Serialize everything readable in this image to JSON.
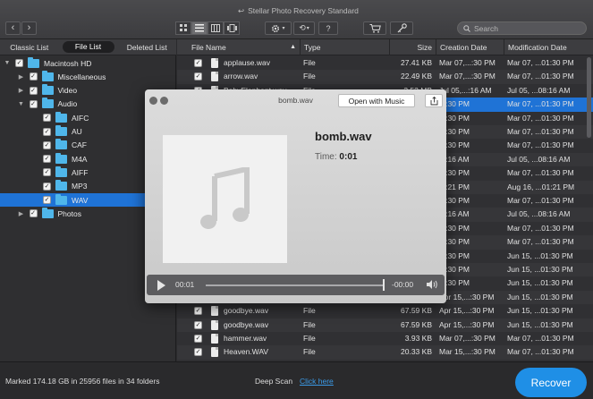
{
  "app": {
    "title": "Stellar Photo Recovery Standard"
  },
  "toolbar": {
    "back": "‹",
    "forward": "›",
    "search_placeholder": "Search",
    "history_label": "⟲",
    "help_label": "?"
  },
  "left_tabs": [
    "Classic List",
    "File List",
    "Deleted List"
  ],
  "tree": [
    {
      "label": "Macintosh HD",
      "level": 0,
      "arrow": "▼"
    },
    {
      "label": "Miscellaneous",
      "level": 1,
      "arrow": "▶"
    },
    {
      "label": "Video",
      "level": 1,
      "arrow": "▶"
    },
    {
      "label": "Audio",
      "level": 1,
      "arrow": "▼"
    },
    {
      "label": "AIFC",
      "level": 2,
      "arrow": ""
    },
    {
      "label": "AU",
      "level": 2,
      "arrow": ""
    },
    {
      "label": "CAF",
      "level": 2,
      "arrow": ""
    },
    {
      "label": "M4A",
      "level": 2,
      "arrow": ""
    },
    {
      "label": "AIFF",
      "level": 2,
      "arrow": ""
    },
    {
      "label": "MP3",
      "level": 2,
      "arrow": ""
    },
    {
      "label": "WAV",
      "level": 2,
      "arrow": "",
      "selected": true
    },
    {
      "label": "Photos",
      "level": 1,
      "arrow": "▶"
    }
  ],
  "table": {
    "headers": {
      "name": "File Name",
      "type": "Type",
      "size": "Size",
      "created": "Creation Date",
      "modified": "Modification Date"
    },
    "rows": [
      {
        "name": "applause.wav",
        "type": "File",
        "size": "27.41 KB",
        "created": "Mar 07,...:30 PM",
        "modified": "Mar 07, ...01:30 PM"
      },
      {
        "name": "arrow.wav",
        "type": "File",
        "size": "22.49 KB",
        "created": "Mar 07,...:30 PM",
        "modified": "Mar 07, ...01:30 PM"
      },
      {
        "name": "BabyElephant.wav",
        "type": "File",
        "size": "3.52 MB",
        "created": "Jul 05,...:16 AM",
        "modified": "Jul 05, ...08:16 AM"
      },
      {
        "name": "bomb.wav",
        "type": "File",
        "size": "",
        "created": "...:30 PM",
        "modified": "Mar 07, ...01:30 PM",
        "selected": true
      },
      {
        "name": "",
        "type": "",
        "size": "",
        "created": "...:30 PM",
        "modified": "Mar 07, ...01:30 PM"
      },
      {
        "name": "",
        "type": "",
        "size": "",
        "created": "...:30 PM",
        "modified": "Mar 07, ...01:30 PM"
      },
      {
        "name": "",
        "type": "",
        "size": "",
        "created": "...:30 PM",
        "modified": "Mar 07, ...01:30 PM"
      },
      {
        "name": "",
        "type": "",
        "size": "",
        "created": "...:16 AM",
        "modified": "Jul 05, ...08:16 AM"
      },
      {
        "name": "",
        "type": "",
        "size": "",
        "created": "...:30 PM",
        "modified": "Mar 07, ...01:30 PM"
      },
      {
        "name": "",
        "type": "",
        "size": "",
        "created": "...:21 PM",
        "modified": "Aug 16, ...01:21 PM"
      },
      {
        "name": "",
        "type": "",
        "size": "",
        "created": "...:30 PM",
        "modified": "Mar 07, ...01:30 PM"
      },
      {
        "name": "",
        "type": "",
        "size": "",
        "created": "...:16 AM",
        "modified": "Jul 05, ...08:16 AM"
      },
      {
        "name": "",
        "type": "",
        "size": "",
        "created": "...:30 PM",
        "modified": "Mar 07, ...01:30 PM"
      },
      {
        "name": "",
        "type": "",
        "size": "",
        "created": "...:30 PM",
        "modified": "Mar 07, ...01:30 PM"
      },
      {
        "name": "",
        "type": "",
        "size": "",
        "created": "...:30 PM",
        "modified": "Jun 15, ...01:30 PM"
      },
      {
        "name": "",
        "type": "",
        "size": "",
        "created": "...:30 PM",
        "modified": "Jun 15, ...01:30 PM"
      },
      {
        "name": "",
        "type": "",
        "size": "",
        "created": "...:30 PM",
        "modified": "Jun 15, ...01:30 PM"
      },
      {
        "name": "goodbye.wav",
        "type": "File",
        "size": "67.59 KB",
        "created": "Apr 15,...:30 PM",
        "modified": "Jun 15, ...01:30 PM"
      },
      {
        "name": "goodbye.wav",
        "type": "File",
        "size": "67.59 KB",
        "created": "Apr 15,...:30 PM",
        "modified": "Jun 15, ...01:30 PM"
      },
      {
        "name": "goodbye.wav",
        "type": "File",
        "size": "67.59 KB",
        "created": "Apr 15,...:30 PM",
        "modified": "Jun 15, ...01:30 PM"
      },
      {
        "name": "hammer.wav",
        "type": "File",
        "size": "3.93 KB",
        "created": "Mar 07,...:30 PM",
        "modified": "Mar 07, ...01:30 PM"
      },
      {
        "name": "Heaven.WAV",
        "type": "File",
        "size": "20.33 KB",
        "created": "Mar 15,...:30 PM",
        "modified": "Mar 07, ...01:30 PM"
      }
    ]
  },
  "status": {
    "marked": "Marked 174.18 GB in 25956 files in 34 folders",
    "deep_scan": "Deep Scan",
    "click_here": "Click here",
    "recover": "Recover"
  },
  "quicklook": {
    "filename": "bomb.wav",
    "open_with": "Open with Music",
    "title": "bomb.wav",
    "time_label": "Time:",
    "time_value": "0:01",
    "current": "00:01",
    "remaining": "-00:00",
    "progress": 1.0
  }
}
